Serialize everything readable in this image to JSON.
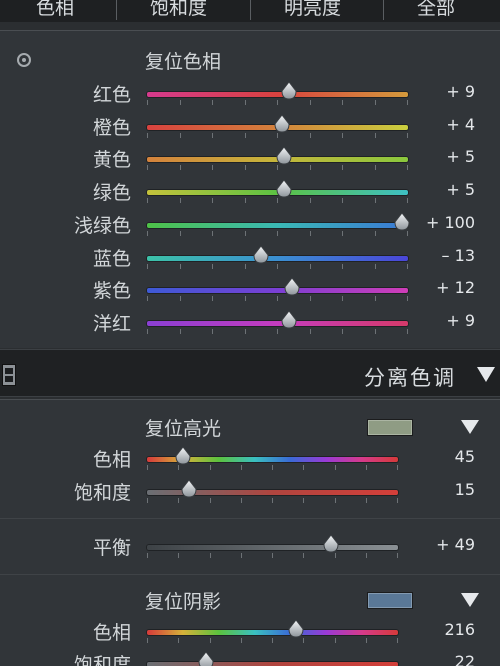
{
  "tabs": [
    {
      "label": "色相"
    },
    {
      "label": "饱和度"
    },
    {
      "label": "明亮度"
    },
    {
      "label": "全部"
    }
  ],
  "hue_panel": {
    "reset_label": "复位色相",
    "target_tool_icon": "target-adjust-icon",
    "sliders": [
      {
        "label": "红色",
        "value": "+ 9",
        "num": 9,
        "min": -100,
        "max": 100,
        "track": [
          "#d63a8e",
          "#d8423f",
          "#d49a3c"
        ]
      },
      {
        "label": "橙色",
        "value": "+ 4",
        "num": 4,
        "min": -100,
        "max": 100,
        "track": [
          "#d8423f",
          "#d4823c",
          "#c9cf3e"
        ]
      },
      {
        "label": "黄色",
        "value": "+ 5",
        "num": 5,
        "min": -100,
        "max": 100,
        "track": [
          "#d4823c",
          "#c5b63b",
          "#8ac83d"
        ]
      },
      {
        "label": "绿色",
        "value": "+ 5",
        "num": 5,
        "min": -100,
        "max": 100,
        "track": [
          "#c5c23b",
          "#5cc243",
          "#3ec0c4"
        ]
      },
      {
        "label": "浅绿色",
        "value": "+ 100",
        "num": 100,
        "min": -100,
        "max": 100,
        "track": [
          "#4ec247",
          "#3ab9b5",
          "#3a78d6"
        ]
      },
      {
        "label": "蓝色",
        "value": "– 13",
        "num": -13,
        "min": -100,
        "max": 100,
        "track": [
          "#3cc2a8",
          "#3b8fd2",
          "#4a46d8"
        ]
      },
      {
        "label": "紫色",
        "value": "+ 12",
        "num": 12,
        "min": -100,
        "max": 100,
        "track": [
          "#3d5ad6",
          "#7a3fd4",
          "#d03db8"
        ]
      },
      {
        "label": "洋红",
        "value": "+ 9",
        "num": 9,
        "min": -100,
        "max": 100,
        "track": [
          "#8a3fd4",
          "#c43cbf",
          "#d63a6a"
        ]
      }
    ]
  },
  "split_toning": {
    "title": "分离色调",
    "toggle_icon": "panel-switch-icon",
    "collapse_icon": "triangle-down-icon",
    "highlights": {
      "reset_label": "复位高光",
      "swatch_color": "#8f9c84",
      "hue": {
        "label": "色相",
        "value": "45",
        "num": 45,
        "min": 0,
        "max": 360
      },
      "saturation": {
        "label": "饱和度",
        "value": "15",
        "num": 15,
        "min": 0,
        "max": 100
      }
    },
    "balance": {
      "label": "平衡",
      "value": "+ 49",
      "num": 49,
      "min": -100,
      "max": 100
    },
    "shadows": {
      "reset_label": "复位阴影",
      "swatch_color": "#5a7897",
      "hue": {
        "label": "色相",
        "value": "216",
        "num": 216,
        "min": 0,
        "max": 360
      },
      "saturation": {
        "label": "饱和度",
        "value": "22",
        "num": 22,
        "min": 0,
        "max": 100
      }
    }
  }
}
